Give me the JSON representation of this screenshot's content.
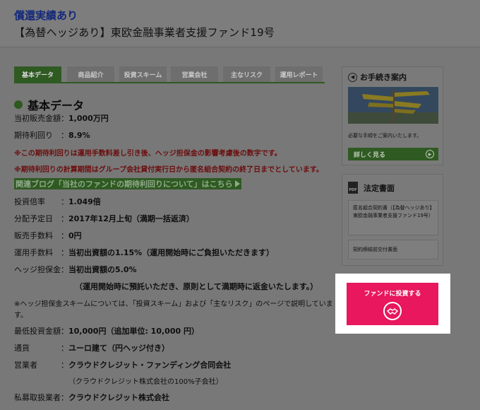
{
  "header": {
    "badge": "償還実績あり",
    "title": "【為替ヘッジあり】東欧金融事業者支援ファンド19号"
  },
  "tabs": [
    {
      "label": "基本データ",
      "active": true
    },
    {
      "label": "商品紹介",
      "active": false
    },
    {
      "label": "投資スキーム",
      "active": false
    },
    {
      "label": "営業会社",
      "active": false
    },
    {
      "label": "主なリスク",
      "active": false
    },
    {
      "label": "運用レポート",
      "active": false
    }
  ],
  "section": {
    "title": "基本データ"
  },
  "basic": {
    "initial_amount": {
      "label": "当初販売金額：",
      "value": "1,000万円"
    },
    "expected_yield": {
      "label": "期待利回り　：",
      "value": "8.9%"
    },
    "note1": "※この期待利回りは運用手数料差し引き後、ヘッジ担保金の影響考慮後の数字です。",
    "note2": "※期待利回りの計算期間はグループ会社貸付実行日から匿名組合契約の終了日までとしています。",
    "blog_link": "関連ブログ「当社のファンドの期待利回りについて」はこちら",
    "multiple": {
      "label": "投資倍率　　：",
      "value": "1.049倍"
    },
    "distribution": {
      "label": "分配予定日　：",
      "value": "2017年12月上旬（満期一括返済）"
    },
    "sales_fee": {
      "label": "販売手数料　：",
      "value": "0円"
    },
    "mgmt_fee": {
      "label": "運用手数料　：",
      "value": "当初出資額の1.15%（運用開始時にご負担いただきます）"
    },
    "hedge": {
      "label": "ヘッジ担保金：",
      "value": "当初出資額の5.0%"
    },
    "hedge_note": "（運用開始時に預託いただき、原則として満期時に返金いたします。）",
    "hedge_scheme_note": "※ヘッジ担保金スキームについては、「投資スキーム」および「主なリスク」のページで説明していま",
    "hedge_scheme_note2": "す。",
    "min_invest": {
      "label": "最低投資金額：",
      "value": "10,000円（追加単位: 10,000 円）"
    },
    "currency": {
      "label": "通貨　　　　：",
      "value": "ユーロ建て（円ヘッジ付き）"
    },
    "operator": {
      "label": "営業者　　　：",
      "value": "クラウドクレジット・ファンディング合同会社"
    },
    "operator_note": "（クラウドクレジット株式会社の100%子会社）",
    "handler": {
      "label": "私募取扱業者：",
      "value": "クラウドクレジット株式会社"
    }
  },
  "sidebar": {
    "procedure": {
      "title": "お手続き案内",
      "note": "必要な手順をご案内いたします。",
      "button": "詳しく見る"
    },
    "legal": {
      "title": "法定書面",
      "doc1": "匿名組合契約書（【為替ヘッジあり】東欧金融事業者支援ファンド19号）",
      "doc2": "契約締結前交付書面"
    },
    "invest_button": "ファンドに投資する"
  },
  "icons": {
    "info": "arrow-circle-icon",
    "pdf": "pdf-icon",
    "handshake": "handshake-icon"
  },
  "colors": {
    "accent_green": "#2f5a22",
    "invest_pink": "#e8175e",
    "badge_blue": "#14297a",
    "note_red": "#6b0d0d"
  }
}
